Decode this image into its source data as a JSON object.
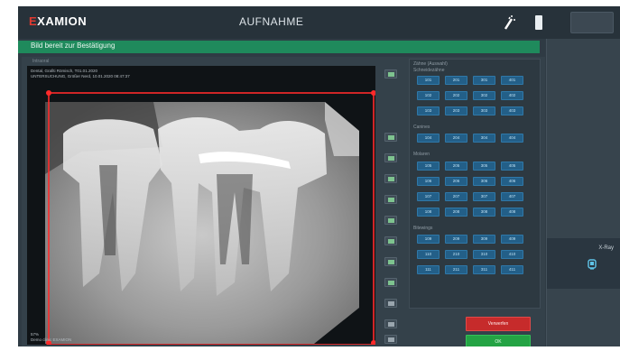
{
  "header": {
    "logo": "EXAMION",
    "title": "AUFNAHME"
  },
  "status": {
    "message": "Bild bereit zur Bestätigung"
  },
  "image": {
    "caption": "Intraoral",
    "meta_line1": "Dental, Grafiti Römisch, T01.01.2020",
    "meta_line2": "UNTERSUCHUNG, Größer Nerd, 10.01.2020 08:47:37",
    "footer_line1": "57%",
    "footer_line2": "Demo clinic EXAMION"
  },
  "tooth_panel": {
    "title": "Zähne (Auswahl)",
    "groups": [
      {
        "label": "Schneidezähne",
        "rows": [
          [
            "101",
            "201",
            "301",
            "401"
          ],
          [
            "102",
            "202",
            "302",
            "402"
          ],
          [
            "103",
            "203",
            "303",
            "403"
          ]
        ]
      },
      {
        "label": "Canines",
        "rows": [
          [
            "104",
            "204",
            "304",
            "404"
          ]
        ]
      },
      {
        "label": "Molaren",
        "rows": [
          [
            "105",
            "205",
            "305",
            "405"
          ],
          [
            "106",
            "206",
            "306",
            "406"
          ],
          [
            "107",
            "207",
            "307",
            "407"
          ],
          [
            "108",
            "208",
            "308",
            "408"
          ]
        ]
      },
      {
        "label": "Bitewings",
        "rows": [
          [
            "109",
            "209",
            "309",
            "409"
          ],
          [
            "110",
            "210",
            "310",
            "410"
          ],
          [
            "111",
            "211",
            "311",
            "411"
          ]
        ]
      }
    ]
  },
  "actions": {
    "cancel": "Verwerfen",
    "ok": "OK"
  },
  "right_panel": {
    "xray_label": "X-Ray"
  },
  "colors": {
    "accent_red": "#e23a30",
    "status_green": "#1f8a5c",
    "tooth_button": "#235f88",
    "crop_red": "#ff2a2a"
  },
  "icons": [
    "wand-icon",
    "battery-icon",
    "xray-sensor-icon"
  ]
}
